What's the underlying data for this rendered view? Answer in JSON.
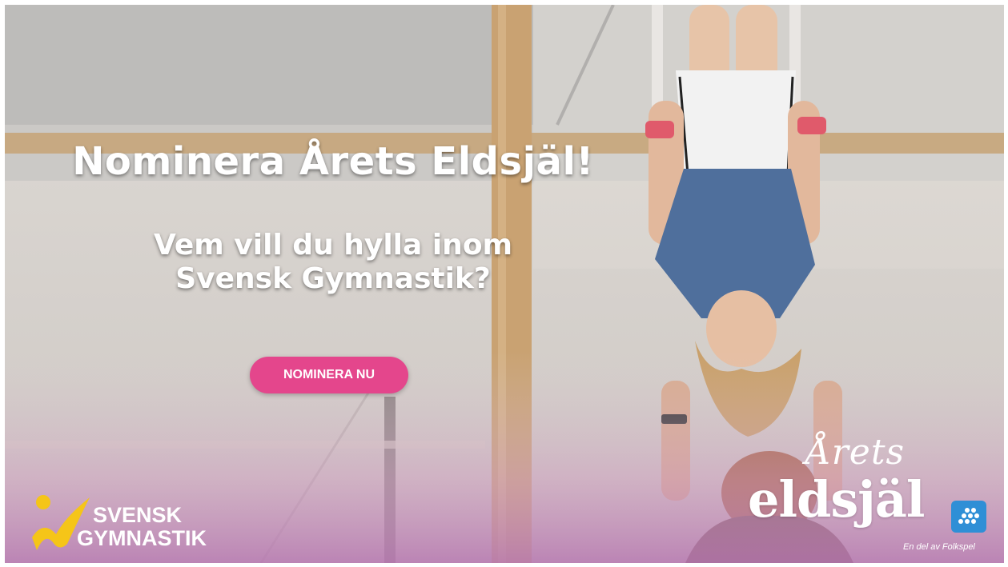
{
  "banner": {
    "headline": "Nominera Årets Eldsjäl!",
    "subheadline_line1": "Vem vill du hylla inom",
    "subheadline_line2": "Svensk Gymnastik?",
    "cta_label": "NOMINERA NU"
  },
  "logos": {
    "svensk_gymnastik": {
      "line1": "SVENSK",
      "line2": "GYMNASTIK",
      "mark_color": "#f5c518"
    },
    "arets_eldsjal": {
      "script": "Årets",
      "wordmark": "eldsjäl",
      "tagline": "En del av Folkspel",
      "badge_color": "#2f8fd6"
    }
  },
  "colors": {
    "cta": "#e4468c",
    "gradient_bottom": "#b77ab0",
    "text": "#ffffff"
  }
}
